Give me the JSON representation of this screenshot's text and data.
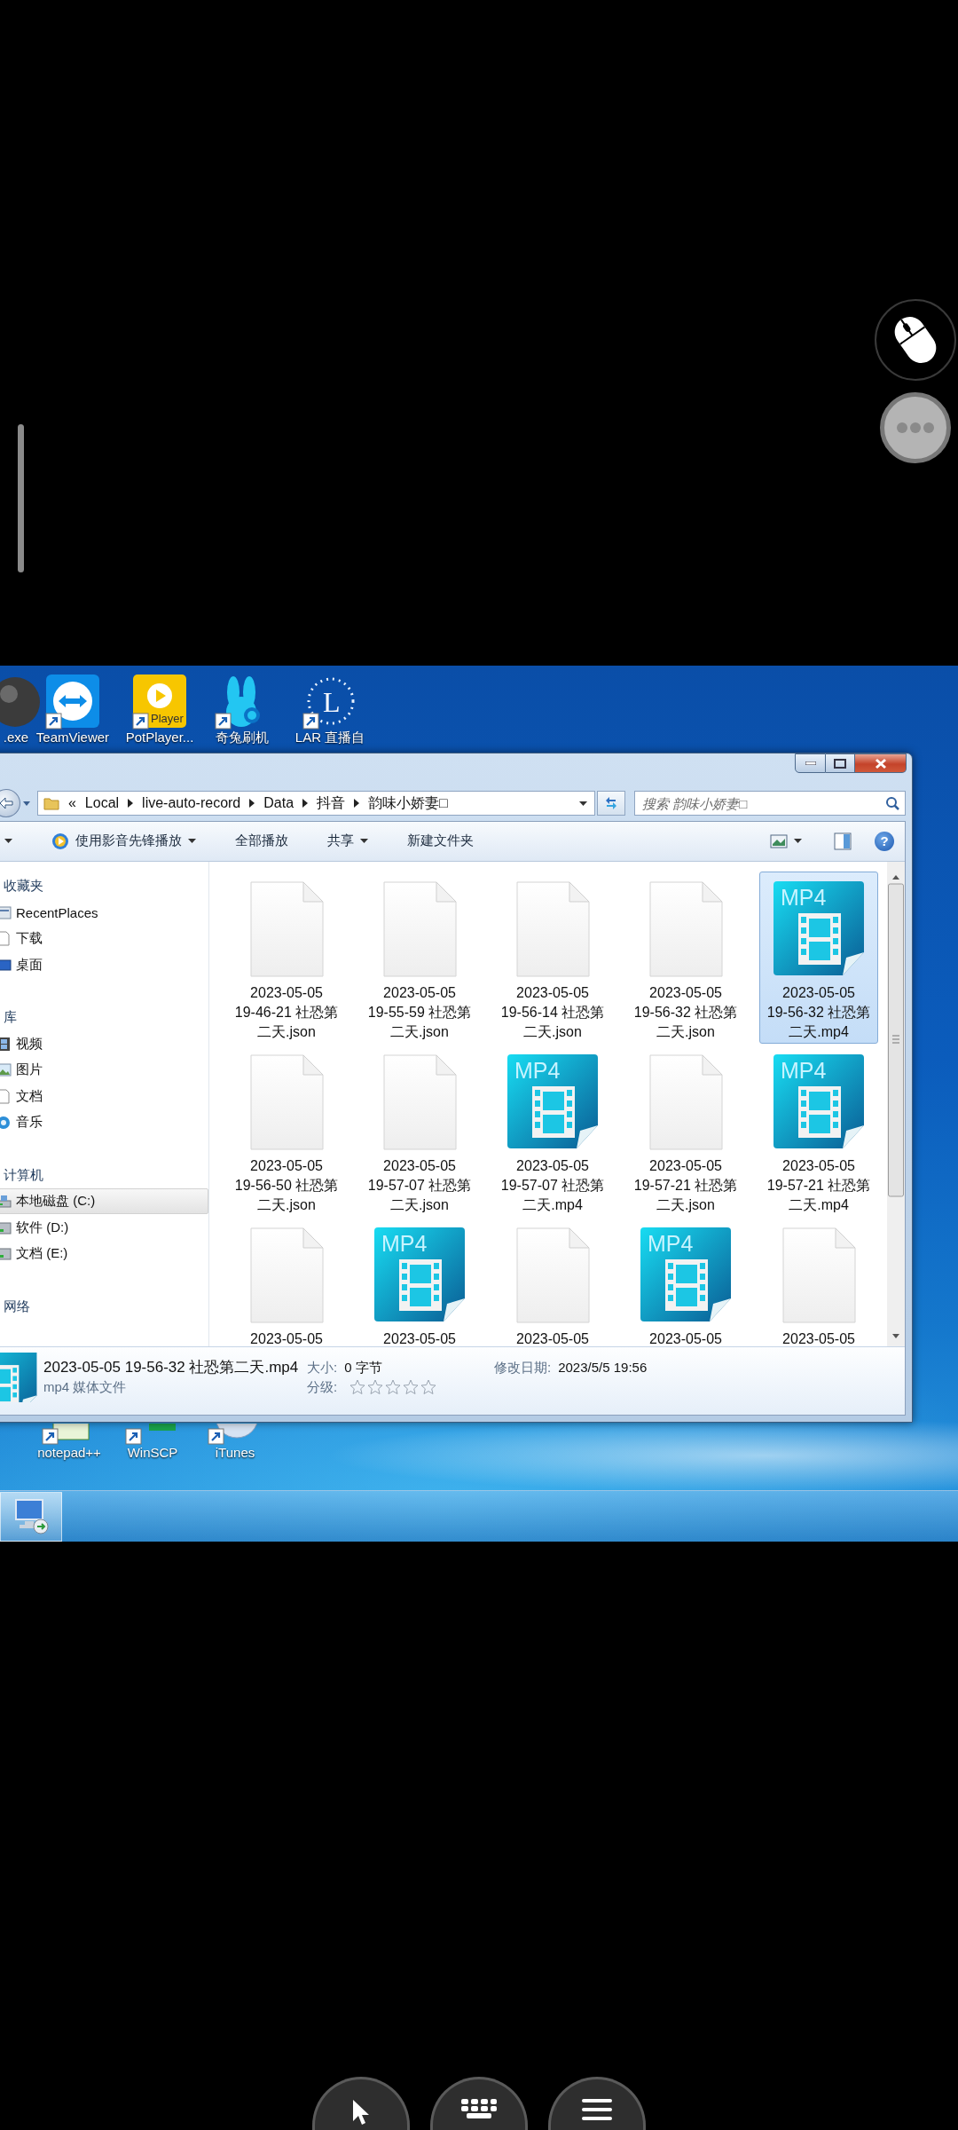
{
  "desktop": {
    "top_icons": [
      {
        "label": ".exe",
        "kind": "orb"
      },
      {
        "label": "TeamViewer",
        "kind": "arrows"
      },
      {
        "label": "PotPlayer...",
        "kind": "player",
        "icon_text": "Player"
      },
      {
        "label": "奇兔刷机",
        "kind": "rabbit"
      },
      {
        "label": "LAR 直播自",
        "kind": "ring",
        "icon_text": "L"
      }
    ],
    "bottom_icons": [
      {
        "label": "notepad++",
        "kind": "notepad"
      },
      {
        "label": "WinSCP",
        "kind": "winscp"
      },
      {
        "label": "iTunes",
        "kind": "itunes"
      }
    ]
  },
  "explorer": {
    "address": {
      "overflow": "«",
      "crumbs": [
        "Local",
        "live-auto-record",
        "Data",
        "抖音",
        "韵味小娇妻□"
      ]
    },
    "search": {
      "placeholder": "搜索 韵味小娇妻□"
    },
    "toolbar": [
      {
        "dropdown": true
      },
      {
        "label": "使用影音先锋播放",
        "kind": "player",
        "dropdown": true
      },
      {
        "label": "全部播放",
        "dropdown": false
      },
      {
        "label": "共享",
        "dropdown": true
      },
      {
        "label": "新建文件夹",
        "dropdown": false
      }
    ],
    "help": "?",
    "nav": [
      {
        "heading": "收藏夹",
        "items": [
          {
            "label": "RecentPlaces",
            "kind": "recent",
            "selected": false
          },
          {
            "label": "下载",
            "kind": "page",
            "selected": false
          },
          {
            "label": "桌面",
            "kind": "desktop",
            "selected": false
          }
        ]
      },
      {
        "heading": "库",
        "items": [
          {
            "label": "视频",
            "kind": "video",
            "selected": false
          },
          {
            "label": "图片",
            "kind": "picture",
            "selected": false
          },
          {
            "label": "文档",
            "kind": "page",
            "selected": false
          },
          {
            "label": "音乐",
            "kind": "music",
            "selected": false
          }
        ]
      },
      {
        "heading": "计算机",
        "items": [
          {
            "label": "本地磁盘 (C:)",
            "kind": "system-drive",
            "selected": true
          },
          {
            "label": "软件 (D:)",
            "kind": "drive",
            "selected": false
          },
          {
            "label": "文档 (E:)",
            "kind": "drive",
            "selected": false
          }
        ]
      },
      {
        "heading": "网络"
      }
    ],
    "files": [
      {
        "kind": "document",
        "lines": [
          "2023-05-05",
          "19-46-21 社恐第",
          "二天.json"
        ],
        "selected": false
      },
      {
        "kind": "document",
        "lines": [
          "2023-05-05",
          "19-55-59 社恐第",
          "二天.json"
        ],
        "selected": false
      },
      {
        "kind": "document",
        "lines": [
          "2023-05-05",
          "19-56-14 社恐第",
          "二天.json"
        ],
        "selected": false
      },
      {
        "kind": "document",
        "lines": [
          "2023-05-05",
          "19-56-32 社恐第",
          "二天.json"
        ],
        "selected": false
      },
      {
        "kind": "video",
        "icon_text": "MP4",
        "lines": [
          "2023-05-05",
          "19-56-32 社恐第",
          "二天.mp4"
        ],
        "selected": true
      },
      {
        "kind": "document",
        "lines": [
          "2023-05-05",
          "19-56-50 社恐第",
          "二天.json"
        ],
        "selected": false
      },
      {
        "kind": "document",
        "lines": [
          "2023-05-05",
          "19-57-07 社恐第",
          "二天.json"
        ],
        "selected": false
      },
      {
        "kind": "video",
        "icon_text": "MP4",
        "lines": [
          "2023-05-05",
          "19-57-07 社恐第",
          "二天.mp4"
        ],
        "selected": false
      },
      {
        "kind": "document",
        "lines": [
          "2023-05-05",
          "19-57-21 社恐第",
          "二天.json"
        ],
        "selected": false
      },
      {
        "kind": "video",
        "icon_text": "MP4",
        "lines": [
          "2023-05-05",
          "19-57-21 社恐第",
          "二天.mp4"
        ],
        "selected": false
      },
      {
        "kind": "document",
        "lines": [
          "2023-05-05"
        ],
        "selected": false
      },
      {
        "kind": "video",
        "icon_text": "MP4",
        "lines": [
          "2023-05-05"
        ],
        "selected": false
      },
      {
        "kind": "document",
        "lines": [
          "2023-05-05"
        ],
        "selected": false
      },
      {
        "kind": "video",
        "icon_text": "MP4",
        "lines": [
          "2023-05-05"
        ],
        "selected": false
      },
      {
        "kind": "document",
        "lines": [
          "2023-05-05"
        ],
        "selected": false
      }
    ],
    "details": {
      "name": "2023-05-05 19-56-32 社恐第二天.mp4",
      "type": "mp4 媒体文件",
      "size_label": "大小:",
      "size": "0 字节",
      "rating_label": "分级:",
      "stars": 0,
      "modified_label": "修改日期:",
      "modified": "2023/5/5 19:56"
    }
  }
}
